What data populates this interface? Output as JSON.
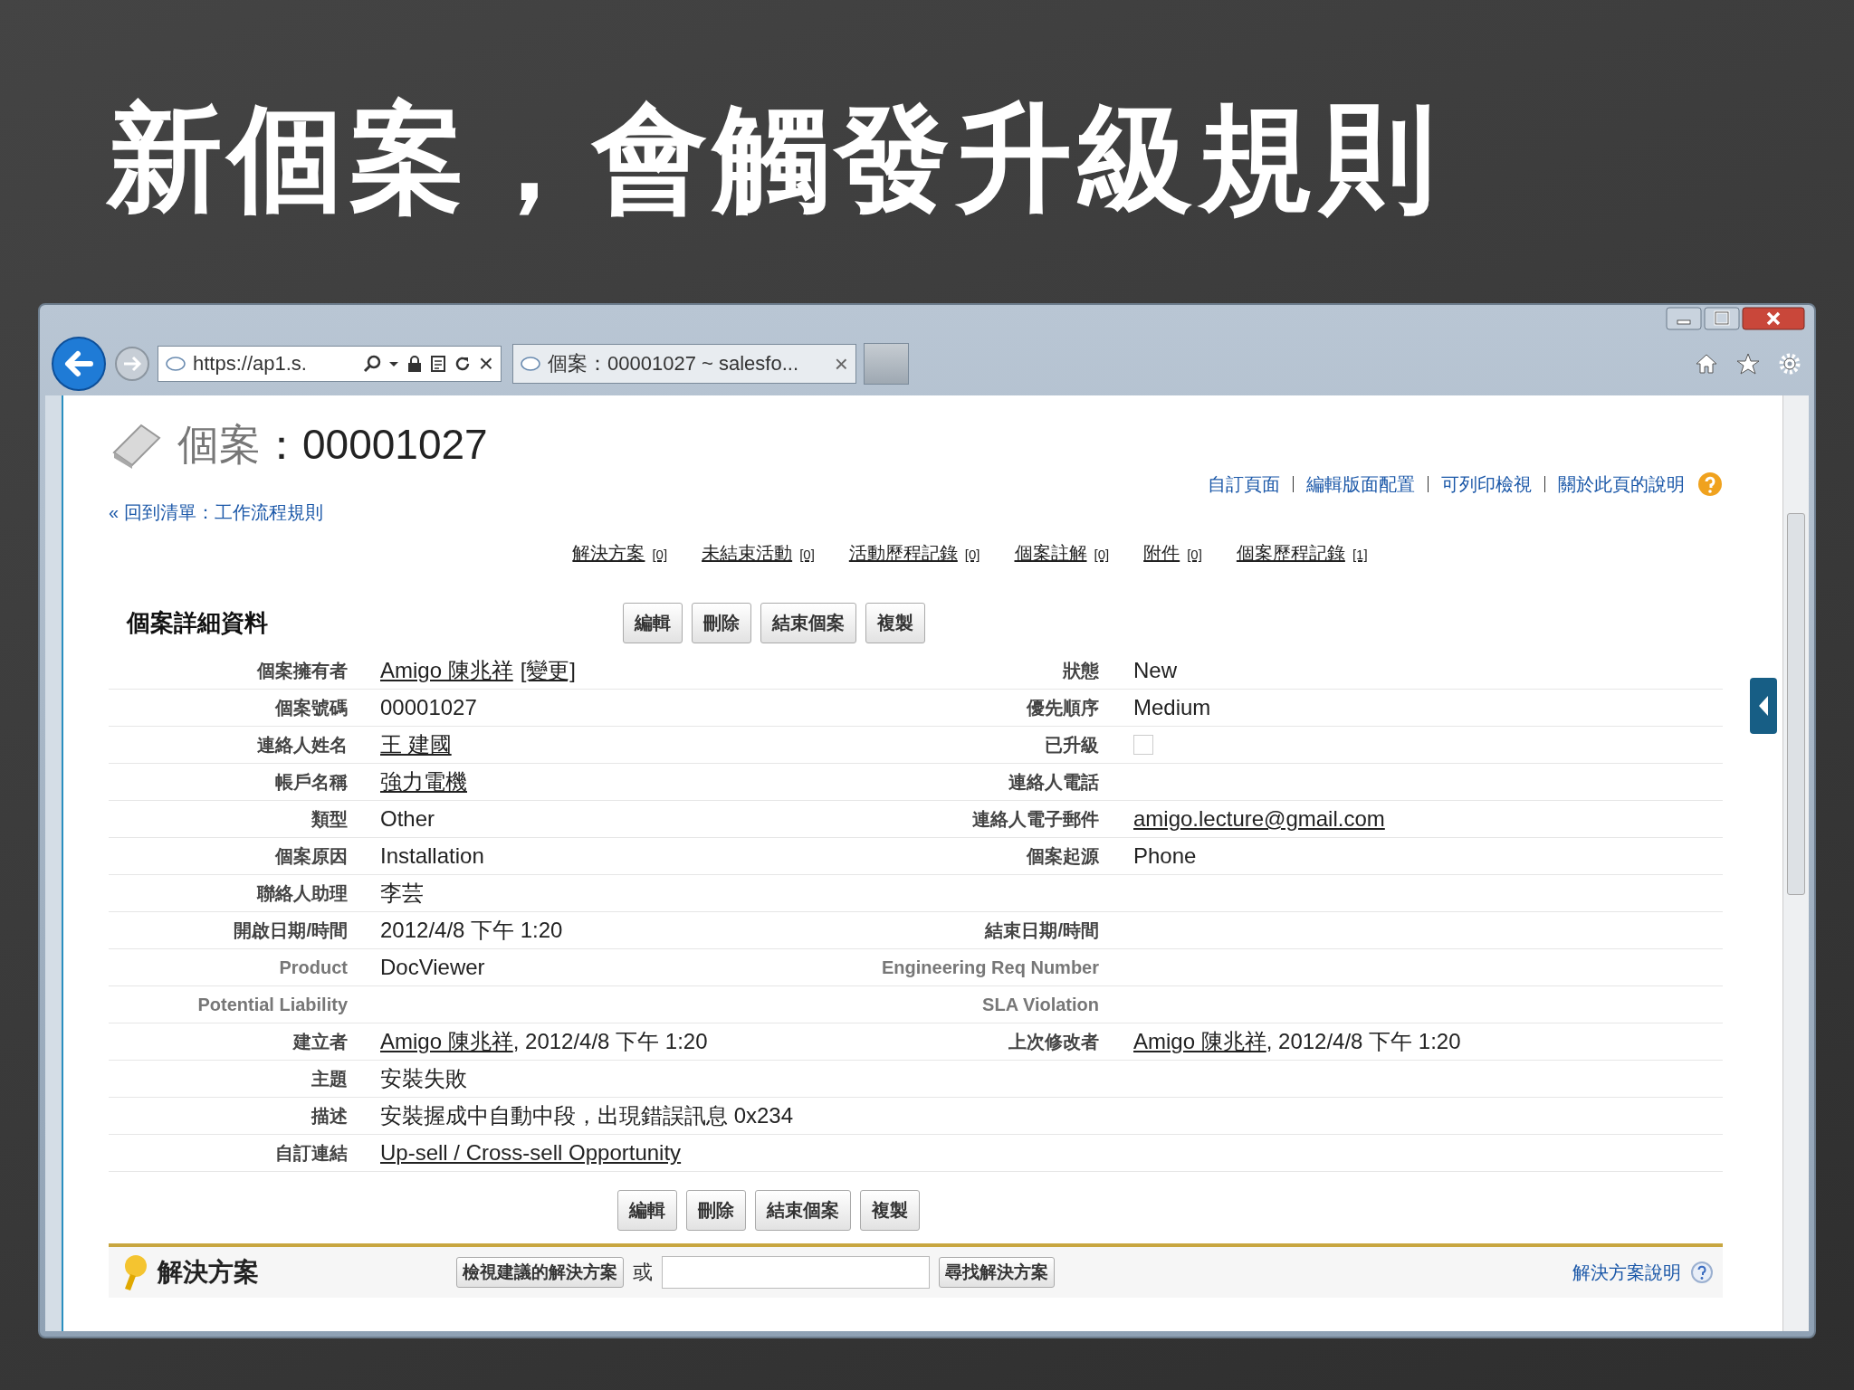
{
  "slide_title": "新個案，會觸發升級規則",
  "browser": {
    "address": "https://ap1.s.",
    "tab_title": "個案：00001027 ~ salesfo...",
    "tab_close": "×",
    "address_stop": "×"
  },
  "page": {
    "title_prefix": "個案",
    "title_sep": "：",
    "title_number": "00001027",
    "back_link": "« 回到清單：工作流程規則",
    "top_links": [
      "自訂頁面",
      "編輯版面配置",
      "可列印檢視",
      "關於此頁的說明"
    ],
    "related_links": [
      {
        "label": "解決方案",
        "count": "[0]"
      },
      {
        "label": "未結束活動",
        "count": "[0]"
      },
      {
        "label": "活動歷程記錄",
        "count": "[0]"
      },
      {
        "label": "個案註解",
        "count": "[0]"
      },
      {
        "label": "附件",
        "count": "[0]"
      },
      {
        "label": "個案歷程記錄",
        "count": "[1]"
      }
    ],
    "section_title": "個案詳細資料",
    "buttons_top": [
      "編輯",
      "刪除",
      "結束個案",
      "複製"
    ],
    "buttons_bottom": [
      "編輯",
      "刪除",
      "結束個案",
      "複製"
    ],
    "rows": [
      {
        "left": {
          "label": "個案擁有者",
          "custom": false,
          "value": [
            {
              "text": "Amigo 陳兆祥",
              "link": true
            },
            {
              "text": "[變更]",
              "link": true
            }
          ]
        },
        "right": {
          "label": "狀態",
          "custom": false,
          "value": [
            {
              "text": "New",
              "link": false
            }
          ]
        }
      },
      {
        "left": {
          "label": "個案號碼",
          "custom": false,
          "value": [
            {
              "text": "00001027",
              "link": false
            }
          ]
        },
        "right": {
          "label": "優先順序",
          "custom": false,
          "value": [
            {
              "text": "Medium",
              "link": false
            }
          ]
        }
      },
      {
        "left": {
          "label": "連絡人姓名",
          "custom": false,
          "value": [
            {
              "text": "王 建國",
              "link": true
            }
          ]
        },
        "right": {
          "label": "已升級",
          "custom": false,
          "checkbox": {
            "checked": false
          }
        }
      },
      {
        "left": {
          "label": "帳戶名稱",
          "custom": false,
          "value": [
            {
              "text": "強力電機",
              "link": true
            }
          ]
        },
        "right": {
          "label": "連絡人電話",
          "custom": false
        }
      },
      {
        "left": {
          "label": "類型",
          "custom": false,
          "value": [
            {
              "text": "Other",
              "link": false
            }
          ]
        },
        "right": {
          "label": "連絡人電子郵件",
          "custom": false,
          "value": [
            {
              "text": "amigo.lecture@gmail.com",
              "link": true
            }
          ]
        }
      },
      {
        "left": {
          "label": "個案原因",
          "custom": false,
          "value": [
            {
              "text": "Installation",
              "link": false
            }
          ]
        },
        "right": {
          "label": "個案起源",
          "custom": false,
          "value": [
            {
              "text": "Phone",
              "link": false
            }
          ]
        }
      },
      {
        "left": {
          "label": "聯絡人助理",
          "custom": false,
          "value": [
            {
              "text": "李芸",
              "link": false
            }
          ]
        }
      },
      {
        "left": {
          "label": "開啟日期/時間",
          "custom": false,
          "value": [
            {
              "text": "2012/4/8 下午 1:20",
              "link": false
            }
          ]
        },
        "right": {
          "label": "結束日期/時間",
          "custom": false
        }
      },
      {
        "left": {
          "label": "Product",
          "custom": true,
          "value": [
            {
              "text": "DocViewer",
              "link": false
            }
          ]
        },
        "right": {
          "label": "Engineering Req Number",
          "custom": true
        }
      },
      {
        "left": {
          "label": "Potential Liability",
          "custom": true
        },
        "right": {
          "label": "SLA Violation",
          "custom": true
        }
      },
      {
        "left": {
          "label": "建立者",
          "custom": false,
          "value": [
            {
              "text": "Amigo 陳兆祥",
              "link": true
            },
            {
              "text": ", 2012/4/8 下午 1:20",
              "link": false
            }
          ]
        },
        "right": {
          "label": "上次修改者",
          "custom": false,
          "value": [
            {
              "text": "Amigo 陳兆祥",
              "link": true
            },
            {
              "text": ", 2012/4/8 下午 1:20",
              "link": false
            }
          ]
        }
      },
      {
        "left": {
          "label": "主題",
          "custom": false,
          "value": [
            {
              "text": "安裝失敗",
              "link": false
            }
          ]
        }
      },
      {
        "left": {
          "label": "描述",
          "custom": false,
          "value": [
            {
              "text": "安裝握成中自動中段，出現錯誤訊息 0x234",
              "link": false
            }
          ]
        }
      },
      {
        "left": {
          "label": "自訂連結",
          "custom": false,
          "value": [
            {
              "text": "Up-sell / Cross-sell Opportunity",
              "link": true
            }
          ]
        }
      }
    ],
    "solutions": {
      "title": "解決方案",
      "view_button": "檢視建議的解決方案",
      "or": "或",
      "find_button": "尋找解決方案",
      "help_link": "解決方案說明"
    }
  }
}
